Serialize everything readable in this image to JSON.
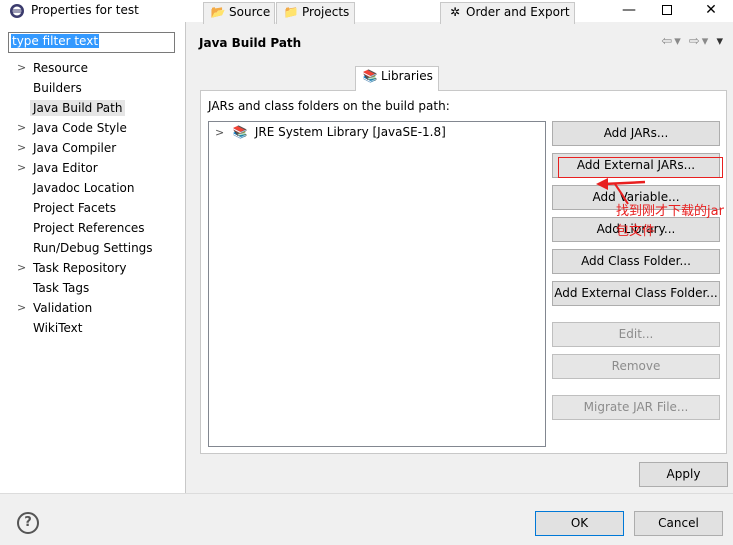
{
  "window": {
    "title": "Properties for test",
    "minimize": "—",
    "close": "✕"
  },
  "filter": {
    "value": "type filter text"
  },
  "tree": {
    "items": [
      {
        "label": "Resource",
        "expandable": true
      },
      {
        "label": "Builders",
        "expandable": false
      },
      {
        "label": "Java Build Path",
        "expandable": false,
        "selected": true
      },
      {
        "label": "Java Code Style",
        "expandable": true
      },
      {
        "label": "Java Compiler",
        "expandable": true
      },
      {
        "label": "Java Editor",
        "expandable": true
      },
      {
        "label": "Javadoc Location",
        "expandable": false
      },
      {
        "label": "Project Facets",
        "expandable": false
      },
      {
        "label": "Project References",
        "expandable": false
      },
      {
        "label": "Run/Debug Settings",
        "expandable": false
      },
      {
        "label": "Task Repository",
        "expandable": true
      },
      {
        "label": "Task Tags",
        "expandable": false
      },
      {
        "label": "Validation",
        "expandable": true
      },
      {
        "label": "WikiText",
        "expandable": false
      }
    ]
  },
  "header": {
    "title": "Java Build Path"
  },
  "tabs": [
    {
      "label": "Source",
      "icon": "source-folder-icon"
    },
    {
      "label": "Projects",
      "icon": "projects-icon"
    },
    {
      "label": "Libraries",
      "icon": "libraries-icon",
      "active": true
    },
    {
      "label": "Order and Export",
      "icon": "order-export-icon"
    }
  ],
  "libraries": {
    "label": "JARs and class folders on the build path:",
    "items": [
      {
        "label": "JRE System Library [JavaSE-1.8]"
      }
    ]
  },
  "buttons": {
    "add_jars": "Add JARs...",
    "add_external_jars": "Add External JARs...",
    "add_variable": "Add Variable...",
    "add_library": "Add Library...",
    "add_class_folder": "Add Class Folder...",
    "add_external_class_folder": "Add External Class Folder...",
    "edit": "Edit...",
    "remove": "Remove",
    "migrate_jar": "Migrate JAR File...",
    "apply": "Apply",
    "ok": "OK",
    "cancel": "Cancel"
  },
  "annotation": {
    "text": "找到刚才下载的jar包文件",
    "color": "#e82020"
  },
  "help": {
    "glyph": "?"
  }
}
